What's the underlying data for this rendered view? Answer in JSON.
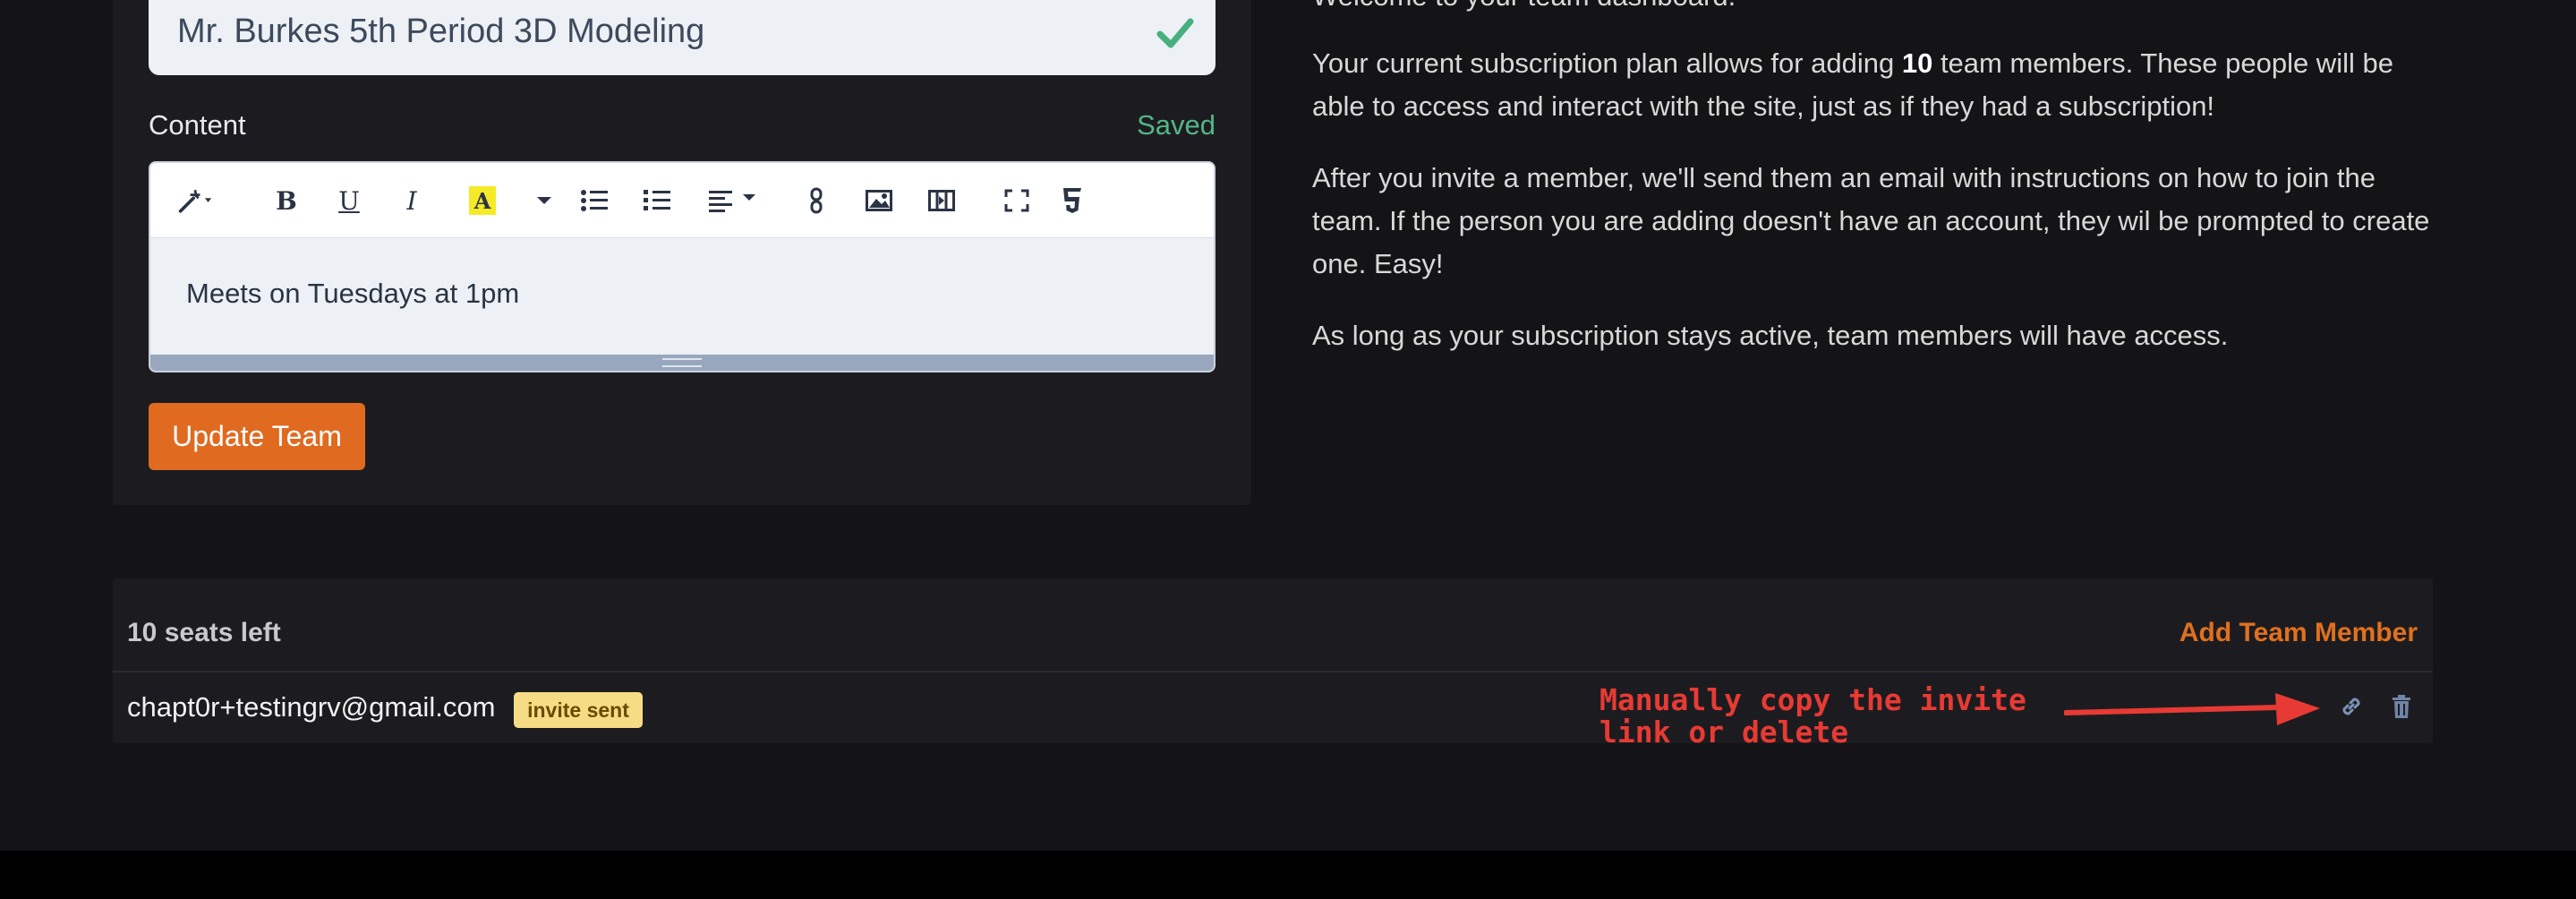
{
  "team_form": {
    "name_value": "Mr. Burkes 5th Period 3D Modeling",
    "content_label": "Content",
    "saved_status": "Saved",
    "editor_content": "Meets on Tuesdays at 1pm",
    "update_button": "Update Team"
  },
  "toolbar": {
    "buttons": [
      "magic-wand",
      "bold",
      "underline",
      "italic",
      "highlight-color",
      "unordered-list",
      "ordered-list",
      "align",
      "link",
      "image",
      "video",
      "fullscreen",
      "html5-source"
    ],
    "bold_glyph": "B",
    "underline_glyph": "U",
    "italic_glyph": "I",
    "color_glyph": "A"
  },
  "info": {
    "heading": "Welcome to your team dashboard.",
    "p1_a": "Your current subscription plan allows for adding ",
    "p1_count": "10",
    "p1_b": " team members. These people will be able to access and interact with the site, just as if they had a subscription!",
    "p2": "After you invite a member, we'll send them an email with instructions on how to join the team. If the person you are adding doesn't have an account, they wil be prompted to create one. Easy!",
    "p3": "As long as your subscription stays active, team members will have access."
  },
  "members": {
    "seats_left": "10 seats left",
    "add_button": "Add Team Member",
    "rows": [
      {
        "email": "chapt0r+testingrv@gmail.com",
        "status": "invite sent"
      }
    ]
  },
  "annotation": {
    "text": "Manually copy the invite\nlink or delete",
    "color": "#e83a34"
  },
  "colors": {
    "accent": "#e06a20",
    "success": "#55b487",
    "badge_bg": "#f7dc86",
    "background": "#141416"
  }
}
